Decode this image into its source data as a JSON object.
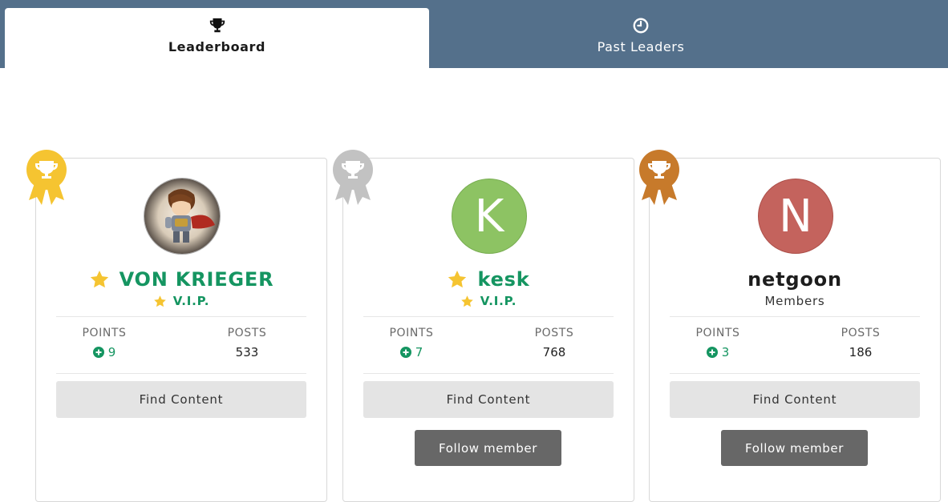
{
  "tabs": [
    {
      "label": "Leaderboard",
      "icon": "trophy-icon",
      "active": true
    },
    {
      "label": "Past Leaders",
      "icon": "clock-icon",
      "active": false
    }
  ],
  "colors": {
    "gold": "#f5c431",
    "silver": "#c2c2c2",
    "bronze": "#c77a2b",
    "member_green": "#159561",
    "tab_bar": "#54708b"
  },
  "leaders": [
    {
      "rank_icon": "gold-trophy-ribbon-icon",
      "avatar_type": "image",
      "avatar_letter": "",
      "name": "VON KRIEGER",
      "role": "V.I.P.",
      "points_label": "POINTS",
      "points": "9",
      "posts_label": "POSTS",
      "posts": "533",
      "find_content": "Find Content",
      "follow": ""
    },
    {
      "rank_icon": "silver-trophy-ribbon-icon",
      "avatar_type": "letter",
      "avatar_letter": "K",
      "name": "kesk",
      "role": "V.I.P.",
      "points_label": "POINTS",
      "points": "7",
      "posts_label": "POSTS",
      "posts": "768",
      "find_content": "Find Content",
      "follow": "Follow member"
    },
    {
      "rank_icon": "bronze-trophy-ribbon-icon",
      "avatar_type": "letter",
      "avatar_letter": "N",
      "name": "netgoon",
      "role": "Members",
      "points_label": "POINTS",
      "points": "3",
      "posts_label": "POSTS",
      "posts": "186",
      "find_content": "Find Content",
      "follow": "Follow member"
    }
  ]
}
